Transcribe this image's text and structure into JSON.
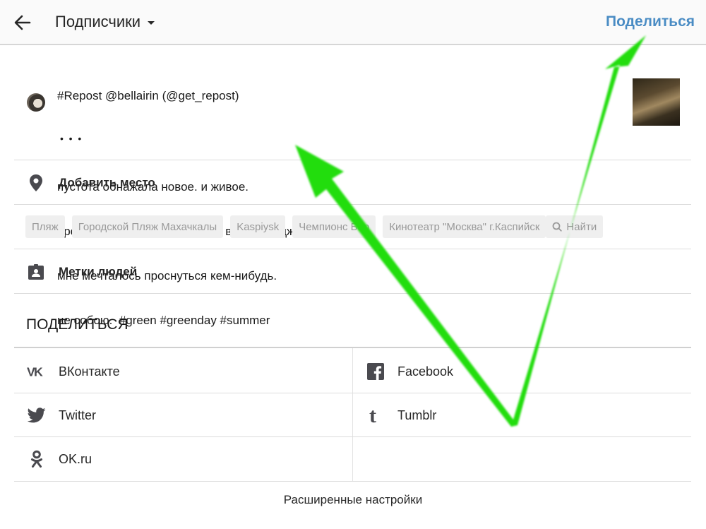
{
  "header": {
    "back_icon": "arrow-left-icon",
    "title": "Подписчики",
    "title_dropdown_icon": "caret-down-icon",
    "share_button": "Поделиться",
    "share_color": "#4a8cc4"
  },
  "post": {
    "caption_lines": [
      "#Repost @bellairin (@get_repost)",
      "•  •  •",
      "пустота обнажала новое. и живое.",
      "проникала в дома и комнаты. внутрь лоджий.",
      "мне мечталось проснуться кем-нибудь.",
      "не собою.  #green #greenday #summer"
    ]
  },
  "location": {
    "icon": "map-pin-icon",
    "label": "Добавить место",
    "suggestions": [
      "Пляж",
      "Городской Пляж Махачкалы",
      "Kaspiysk",
      "Чемпионс Бар",
      "Кинотеатр \"Москва\" г.Каспийск"
    ],
    "search_chip": "Найти",
    "search_icon": "search-icon"
  },
  "tag_people": {
    "icon": "person-badge-icon",
    "label": "Метки людей"
  },
  "share_section": {
    "title": "ПОДЕЛИТЬСЯ",
    "services": [
      {
        "name": "ВКонтакте",
        "icon": "vk-icon"
      },
      {
        "name": "Facebook",
        "icon": "facebook-icon"
      },
      {
        "name": "Twitter",
        "icon": "twitter-icon"
      },
      {
        "name": "Tumblr",
        "icon": "tumblr-icon"
      },
      {
        "name": "OK.ru",
        "icon": "odnoklassniki-icon"
      }
    ]
  },
  "advanced_settings": "Расширенные настройки",
  "annotation": {
    "arrow_color": "#22dd11"
  }
}
